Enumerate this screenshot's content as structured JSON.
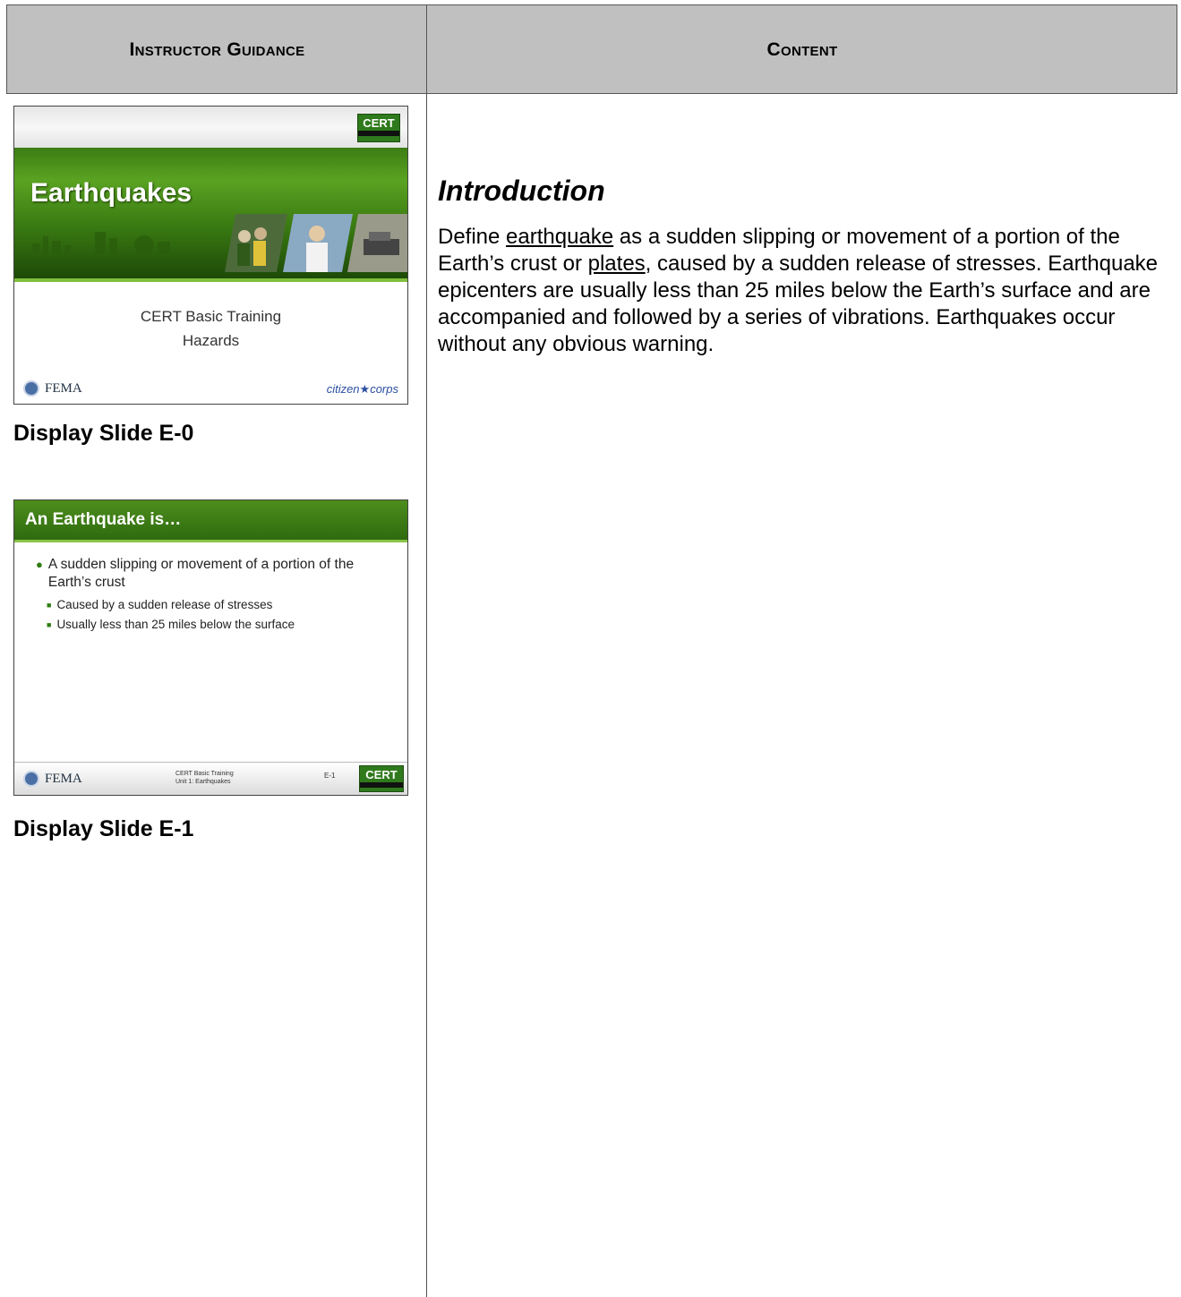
{
  "header": {
    "left_label": "Instructor Guidance",
    "right_label": "Content"
  },
  "slide0": {
    "title": "Earthquakes",
    "subtitle_line1": "CERT Basic Training",
    "subtitle_line2": "Hazards",
    "logo_left": "FEMA",
    "logo_right_a": "citizen",
    "logo_right_b": "corps",
    "cert_logo": "CERT",
    "caption": "Display Slide E-0"
  },
  "slide1": {
    "title": "An Earthquake is…",
    "bullet": "A sudden slipping or movement of a portion of the Earth’s crust",
    "sub_bullets": [
      "Caused by a sudden release of stresses",
      "Usually less than 25 miles below the surface"
    ],
    "footer_logo": "FEMA",
    "footer_line1": "CERT Basic Training",
    "footer_line2": "Unit 1: Earthquakes",
    "footer_number": "E-1",
    "cert_logo": "CERT",
    "caption": "Display Slide E-1"
  },
  "content": {
    "heading": "Introduction",
    "para_part1": "Define ",
    "term1": "earthquake",
    "para_part2": " as a sudden slipping or movement of a portion of the Earth’s crust or ",
    "term2": "plates",
    "para_part3": ", caused by a sudden release of stresses.  Earthquake epicenters are usually less than 25 miles below the Earth’s surface and are accompanied and followed by a series of vibrations.  Earthquakes occur without any obvious warning."
  },
  "colors": {
    "header_bg": "#c0c0c0",
    "slide_green": "#3c7d14",
    "accent_green": "#8cc34a"
  }
}
